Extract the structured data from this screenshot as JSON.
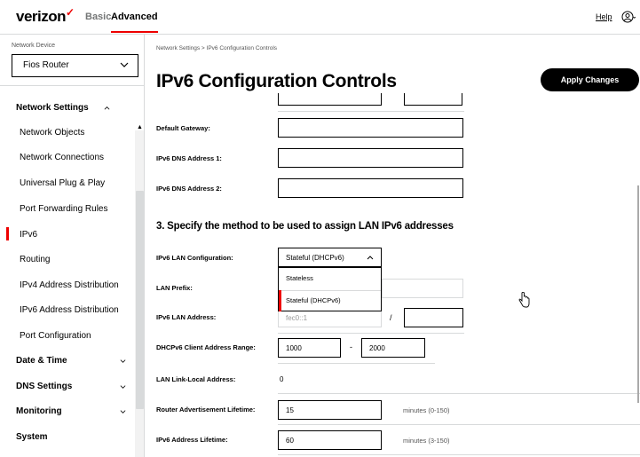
{
  "header": {
    "logo_text": "verizon",
    "logo_check": "✓",
    "tabs": [
      "Basic",
      "Advanced"
    ],
    "help_label": "Help",
    "user_icon": "user-circle-icon"
  },
  "sidebar": {
    "device_label": "Network Device",
    "device_value": "Fios Router",
    "sections": [
      {
        "label": "Network Settings",
        "expanded": true
      },
      {
        "label": "Date & Time",
        "expanded": false
      },
      {
        "label": "DNS Settings",
        "expanded": false
      },
      {
        "label": "Monitoring",
        "expanded": false
      },
      {
        "label": "System",
        "expanded": false
      }
    ],
    "items": [
      "Network Objects",
      "Network Connections",
      "Universal Plug & Play",
      "Port Forwarding Rules",
      "IPv6",
      "Routing",
      "IPv4 Address Distribution",
      "IPv6 Address Distribution",
      "Port Configuration"
    ],
    "active_item": "IPv6",
    "accent_color": "#ee0000"
  },
  "main": {
    "breadcrumb": "Network Settings  >  IPv6 Configuration Controls",
    "title": "IPv6 Configuration Controls",
    "apply_label": "Apply Changes",
    "fields": {
      "default_gateway_label": "Default Gateway:",
      "dns1_label": "IPv6 DNS Address 1:",
      "dns2_label": "IPv6 DNS Address 2:"
    },
    "section3_title": "3. Specify the method to be used to assign LAN IPv6 addresses",
    "lan_config_label": "IPv6 LAN Configuration:",
    "lan_config_value": "Stateful (DHCPv6)",
    "lan_config_options": [
      "Stateless",
      "Stateful (DHCPv6)"
    ],
    "lan_prefix_label": "LAN Prefix:",
    "lan_address_label": "IPv6 LAN Address:",
    "lan_address_value": "fec0::1",
    "slash": "/",
    "dhcp_range_label": "DHCPv6 Client Address Range:",
    "dhcp_range_start": "1000",
    "dhcp_range_dash": "-",
    "dhcp_range_end": "2000",
    "link_local_label": "LAN Link-Local Address:",
    "link_local_value": "0",
    "ra_lifetime_label": "Router Advertisement Lifetime:",
    "ra_lifetime_value": "15",
    "ra_lifetime_hint": "minutes (0-150)",
    "addr_lifetime_label": "IPv6 Address Lifetime:",
    "addr_lifetime_value": "60",
    "addr_lifetime_hint": "minutes (3-150)"
  }
}
